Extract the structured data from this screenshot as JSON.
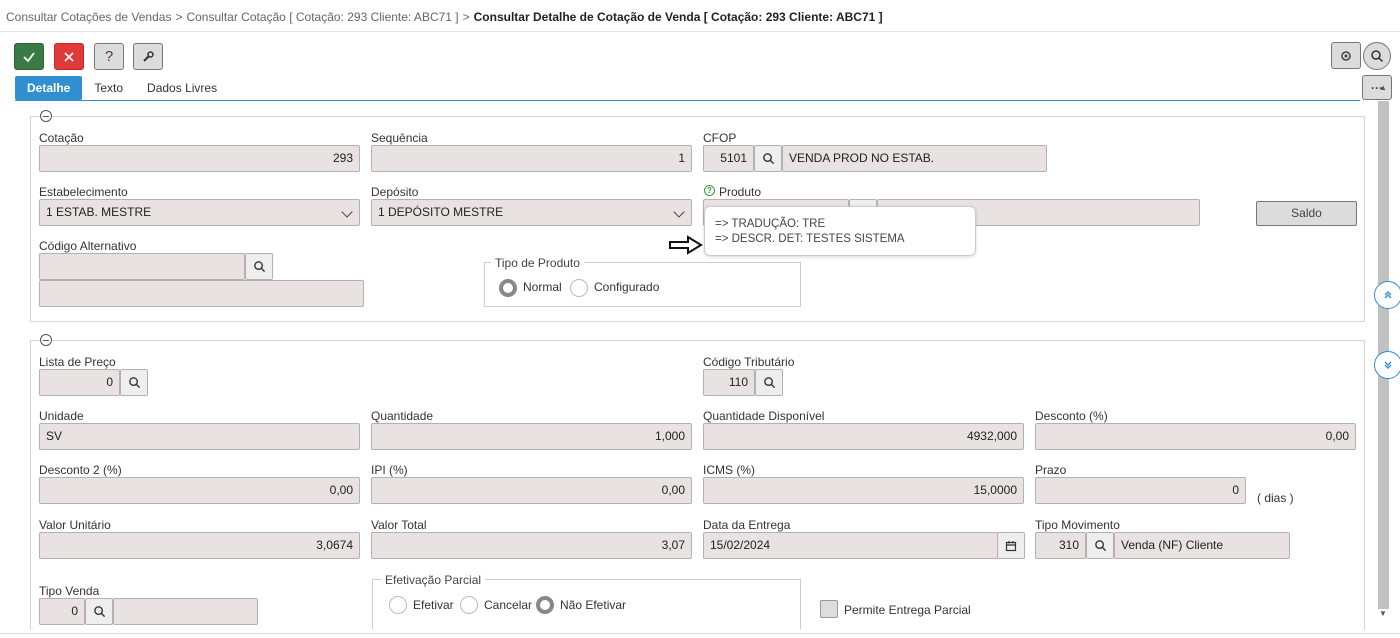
{
  "breadcrumb": {
    "item1": "Consultar Cotações de Vendas",
    "item2": "Consultar Cotação [ Cotação: 293 Cliente: ABC71 ]",
    "current": "Consultar Detalhe de Cotação de Venda [ Cotação: 293 Cliente: ABC71 ]",
    "separator": ">"
  },
  "toolbar": {
    "confirm_icon": "check-icon",
    "cancel_icon": "close-icon",
    "help_label": "?",
    "tools_icon": "wrench-icon",
    "settings_icon": "gear-icon",
    "search_icon": "search-icon",
    "more_label": "···"
  },
  "tabs": [
    {
      "label": "Detalhe",
      "active": true
    },
    {
      "label": "Texto",
      "active": false
    },
    {
      "label": "Dados Livres",
      "active": false
    }
  ],
  "section1": {
    "cotacao": {
      "label": "Cotação",
      "value": "293"
    },
    "sequencia": {
      "label": "Sequência",
      "value": "1"
    },
    "cfop": {
      "label": "CFOP",
      "code": "5101",
      "description": "VENDA PROD NO ESTAB."
    },
    "estabelecimento": {
      "label": "Estabelecimento",
      "value": "1 ESTAB. MESTRE"
    },
    "deposito": {
      "label": "Depósito",
      "value": "1 DEPÓSITO MESTRE"
    },
    "produto": {
      "label": "Produto",
      "code": "",
      "description": ""
    },
    "codigo_alternativo": {
      "label": "Código Alternativo",
      "value": "",
      "description": ""
    },
    "tipo_produto": {
      "title": "Tipo de Produto",
      "options": [
        {
          "label": "Normal",
          "selected": true
        },
        {
          "label": "Configurado",
          "selected": false
        }
      ]
    },
    "saldo_button": "Saldo",
    "tooltip": {
      "line1": "=> TRADUÇÃO: TRE",
      "line2": "=> DESCR. DET: TESTES SISTEMA"
    }
  },
  "section2": {
    "lista_preco": {
      "label": "Lista de Preço",
      "value": "0"
    },
    "codigo_tributario": {
      "label": "Código Tributário",
      "value": "110"
    },
    "unidade": {
      "label": "Unidade",
      "value": "SV"
    },
    "quantidade": {
      "label": "Quantidade",
      "value": "1,000"
    },
    "quantidade_disponivel": {
      "label": "Quantidade Disponível",
      "value": "4932,000"
    },
    "desconto": {
      "label": "Desconto (%)",
      "value": "0,00"
    },
    "desconto2": {
      "label": "Desconto 2 (%)",
      "value": "0,00"
    },
    "ipi": {
      "label": "IPI (%)",
      "value": "0,00"
    },
    "icms": {
      "label": "ICMS (%)",
      "value": "15,0000"
    },
    "prazo": {
      "label": "Prazo",
      "value": "0",
      "unit": "( dias )"
    },
    "valor_unitario": {
      "label": "Valor Unitário",
      "value": "3,0674"
    },
    "valor_total": {
      "label": "Valor Total",
      "value": "3,07"
    },
    "data_entrega": {
      "label": "Data da Entrega",
      "value": "15/02/2024"
    },
    "tipo_movimento": {
      "label": "Tipo Movimento",
      "code": "310",
      "description": "Venda (NF) Cliente"
    },
    "tipo_venda": {
      "label": "Tipo Venda",
      "code": "0",
      "description": ""
    },
    "efetivacao_parcial": {
      "title": "Efetivação Parcial",
      "options": [
        {
          "label": "Efetivar",
          "selected": false
        },
        {
          "label": "Cancelar",
          "selected": false
        },
        {
          "label": "Não Efetivar",
          "selected": true
        }
      ]
    },
    "permite_entrega_parcial": {
      "label": "Permite Entrega Parcial",
      "checked": false
    }
  },
  "colors": {
    "accent": "#2f8fd1",
    "confirm": "#3a7a45",
    "cancel": "#e03a3a",
    "field_bg": "#e8e2e2"
  }
}
